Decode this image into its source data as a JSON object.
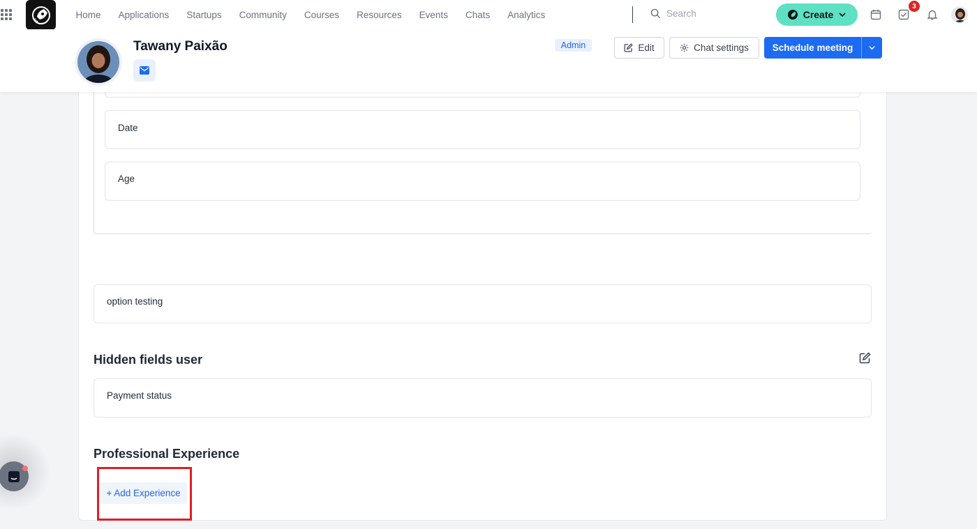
{
  "nav": {
    "items": [
      "Home",
      "Applications",
      "Startups",
      "Community",
      "Courses",
      "Resources",
      "Events",
      "Chats",
      "Analytics"
    ],
    "search_placeholder": "Search",
    "create_label": "Create",
    "tasks_badge": "3"
  },
  "profile": {
    "name": "Tawany Paixão",
    "role_badge": "Admin",
    "edit_label": "Edit",
    "chat_settings_label": "Chat settings",
    "schedule_label": "Schedule meeting"
  },
  "fields": {
    "date_label": "Date",
    "age_label": "Age",
    "option_label": "option testing",
    "payment_label": "Payment status"
  },
  "sections": {
    "hidden_fields_title": "Hidden fields user",
    "experience_title": "Professional Experience",
    "add_experience_label": "+ Add Experience"
  },
  "colors": {
    "accent": "#1d6bf3",
    "create": "#5ee0c3",
    "highlight": "#e11d24",
    "badge": "#dc2626"
  }
}
